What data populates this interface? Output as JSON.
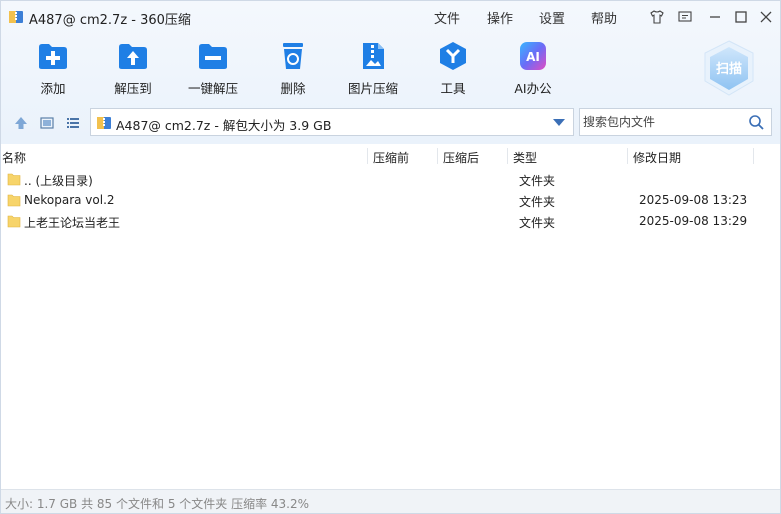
{
  "window": {
    "title": "A487@ cm2.7z - 360压缩",
    "menus": [
      "文件",
      "操作",
      "设置",
      "帮助"
    ]
  },
  "toolbar": {
    "items": [
      {
        "label": "添加",
        "icon": "add-file-icon"
      },
      {
        "label": "解压到",
        "icon": "extract-to-icon"
      },
      {
        "label": "一键解压",
        "icon": "one-click-extract-icon"
      },
      {
        "label": "删除",
        "icon": "delete-icon"
      },
      {
        "label": "图片压缩",
        "icon": "image-compress-icon"
      },
      {
        "label": "工具",
        "icon": "tools-icon"
      },
      {
        "label": "AI办公",
        "icon": "ai-office-icon"
      }
    ],
    "scan_label": "扫描"
  },
  "address": {
    "path": "A487@ cm2.7z - 解包大小为 3.9 GB",
    "search_placeholder": "搜索包内文件"
  },
  "columns": {
    "name": "名称",
    "packed": "压缩前",
    "compressed": "压缩后",
    "type": "类型",
    "modified": "修改日期"
  },
  "rows": [
    {
      "name": ".. (上级目录)",
      "type": "文件夹",
      "date": ""
    },
    {
      "name": "Nekopara vol.2",
      "type": "文件夹",
      "date": "2025-09-08 13:23"
    },
    {
      "name": "上老王论坛当老王",
      "type": "文件夹",
      "date": "2025-09-08 13:29"
    }
  ],
  "status": {
    "text": "大小: 1.7 GB 共 85 个文件和 5 个文件夹 压缩率 43.2%"
  },
  "colors": {
    "accent": "#2a86e0",
    "folder": "#f7d46a",
    "icon_blue": "#1f7fe5"
  }
}
